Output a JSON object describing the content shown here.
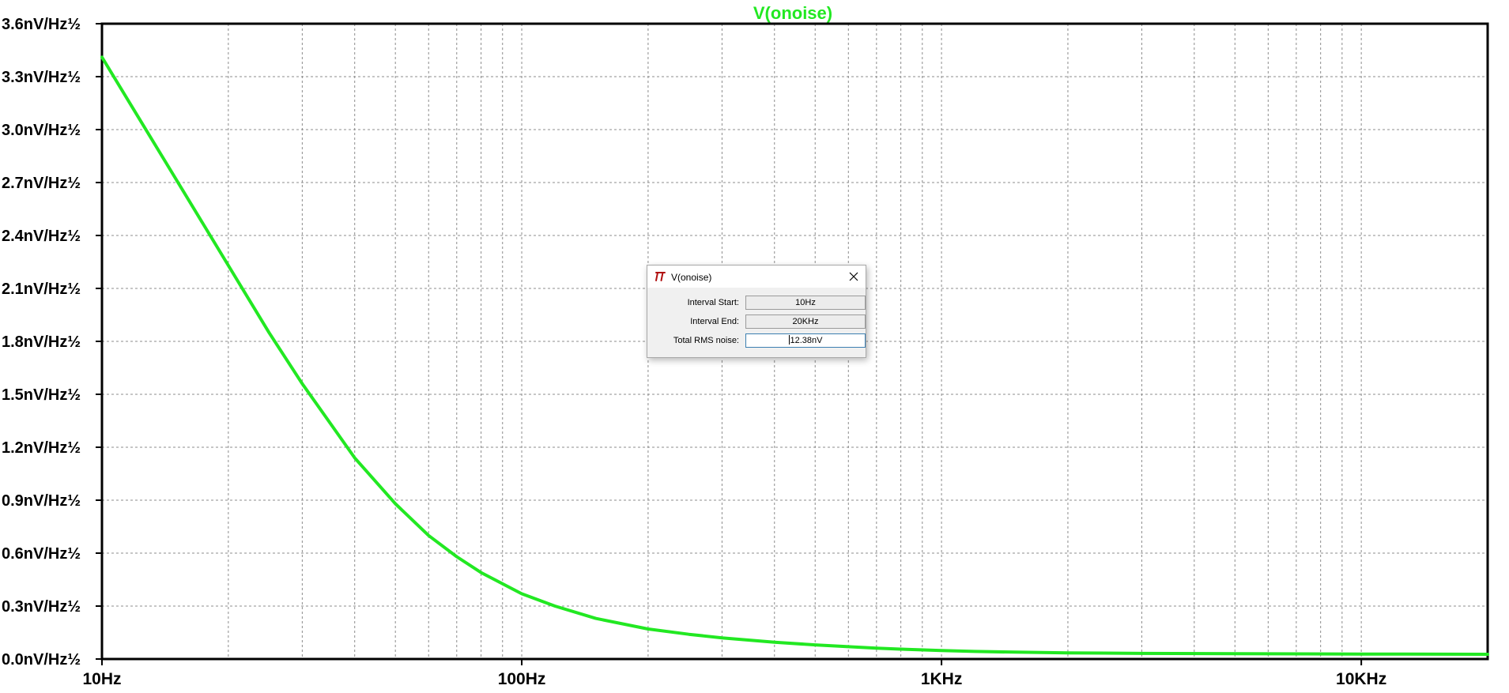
{
  "chart_data": {
    "type": "line",
    "title": "V(onoise)",
    "title_color": "#22e822",
    "trace_color": "#22e822",
    "x_scale": "log",
    "xlim": [
      10,
      20000
    ],
    "ylim": [
      0,
      3.6
    ],
    "grid": true,
    "y_ticks": [
      {
        "value": 3.6,
        "label": "3.6nV/Hz½"
      },
      {
        "value": 3.3,
        "label": "3.3nV/Hz½"
      },
      {
        "value": 3.0,
        "label": "3.0nV/Hz½"
      },
      {
        "value": 2.7,
        "label": "2.7nV/Hz½"
      },
      {
        "value": 2.4,
        "label": "2.4nV/Hz½"
      },
      {
        "value": 2.1,
        "label": "2.1nV/Hz½"
      },
      {
        "value": 1.8,
        "label": "1.8nV/Hz½"
      },
      {
        "value": 1.5,
        "label": "1.5nV/Hz½"
      },
      {
        "value": 1.2,
        "label": "1.2nV/Hz½"
      },
      {
        "value": 0.9,
        "label": "0.9nV/Hz½"
      },
      {
        "value": 0.6,
        "label": "0.6nV/Hz½"
      },
      {
        "value": 0.3,
        "label": "0.3nV/Hz½"
      },
      {
        "value": 0.0,
        "label": "0.0nV/Hz½"
      }
    ],
    "x_ticks": [
      {
        "value": 10,
        "label": "10Hz"
      },
      {
        "value": 100,
        "label": "100Hz"
      },
      {
        "value": 1000,
        "label": "1KHz"
      },
      {
        "value": 10000,
        "label": "10KHz"
      }
    ],
    "series": [
      {
        "name": "V(onoise)",
        "x": [
          10,
          12,
          15,
          20,
          25,
          30,
          40,
          50,
          60,
          70,
          80,
          100,
          120,
          150,
          200,
          250,
          300,
          400,
          500,
          600,
          700,
          800,
          1000,
          1200,
          1500,
          2000,
          3000,
          5000,
          10000,
          20000
        ],
        "y": [
          3.41,
          3.1,
          2.72,
          2.23,
          1.85,
          1.56,
          1.14,
          0.88,
          0.7,
          0.58,
          0.49,
          0.37,
          0.3,
          0.23,
          0.17,
          0.14,
          0.12,
          0.095,
          0.08,
          0.07,
          0.062,
          0.056,
          0.048,
          0.043,
          0.039,
          0.035,
          0.032,
          0.03,
          0.028,
          0.027
        ]
      }
    ]
  },
  "dialog": {
    "title": "V(onoise)",
    "icon": "ltspice-logo-icon",
    "close_icon": "close-icon",
    "interval_start_label": "Interval Start:",
    "interval_start_value": "10Hz",
    "interval_end_label": "Interval End:",
    "interval_end_value": "20KHz",
    "total_rms_label": "Total RMS noise:",
    "total_rms_value": "12.38nV"
  }
}
